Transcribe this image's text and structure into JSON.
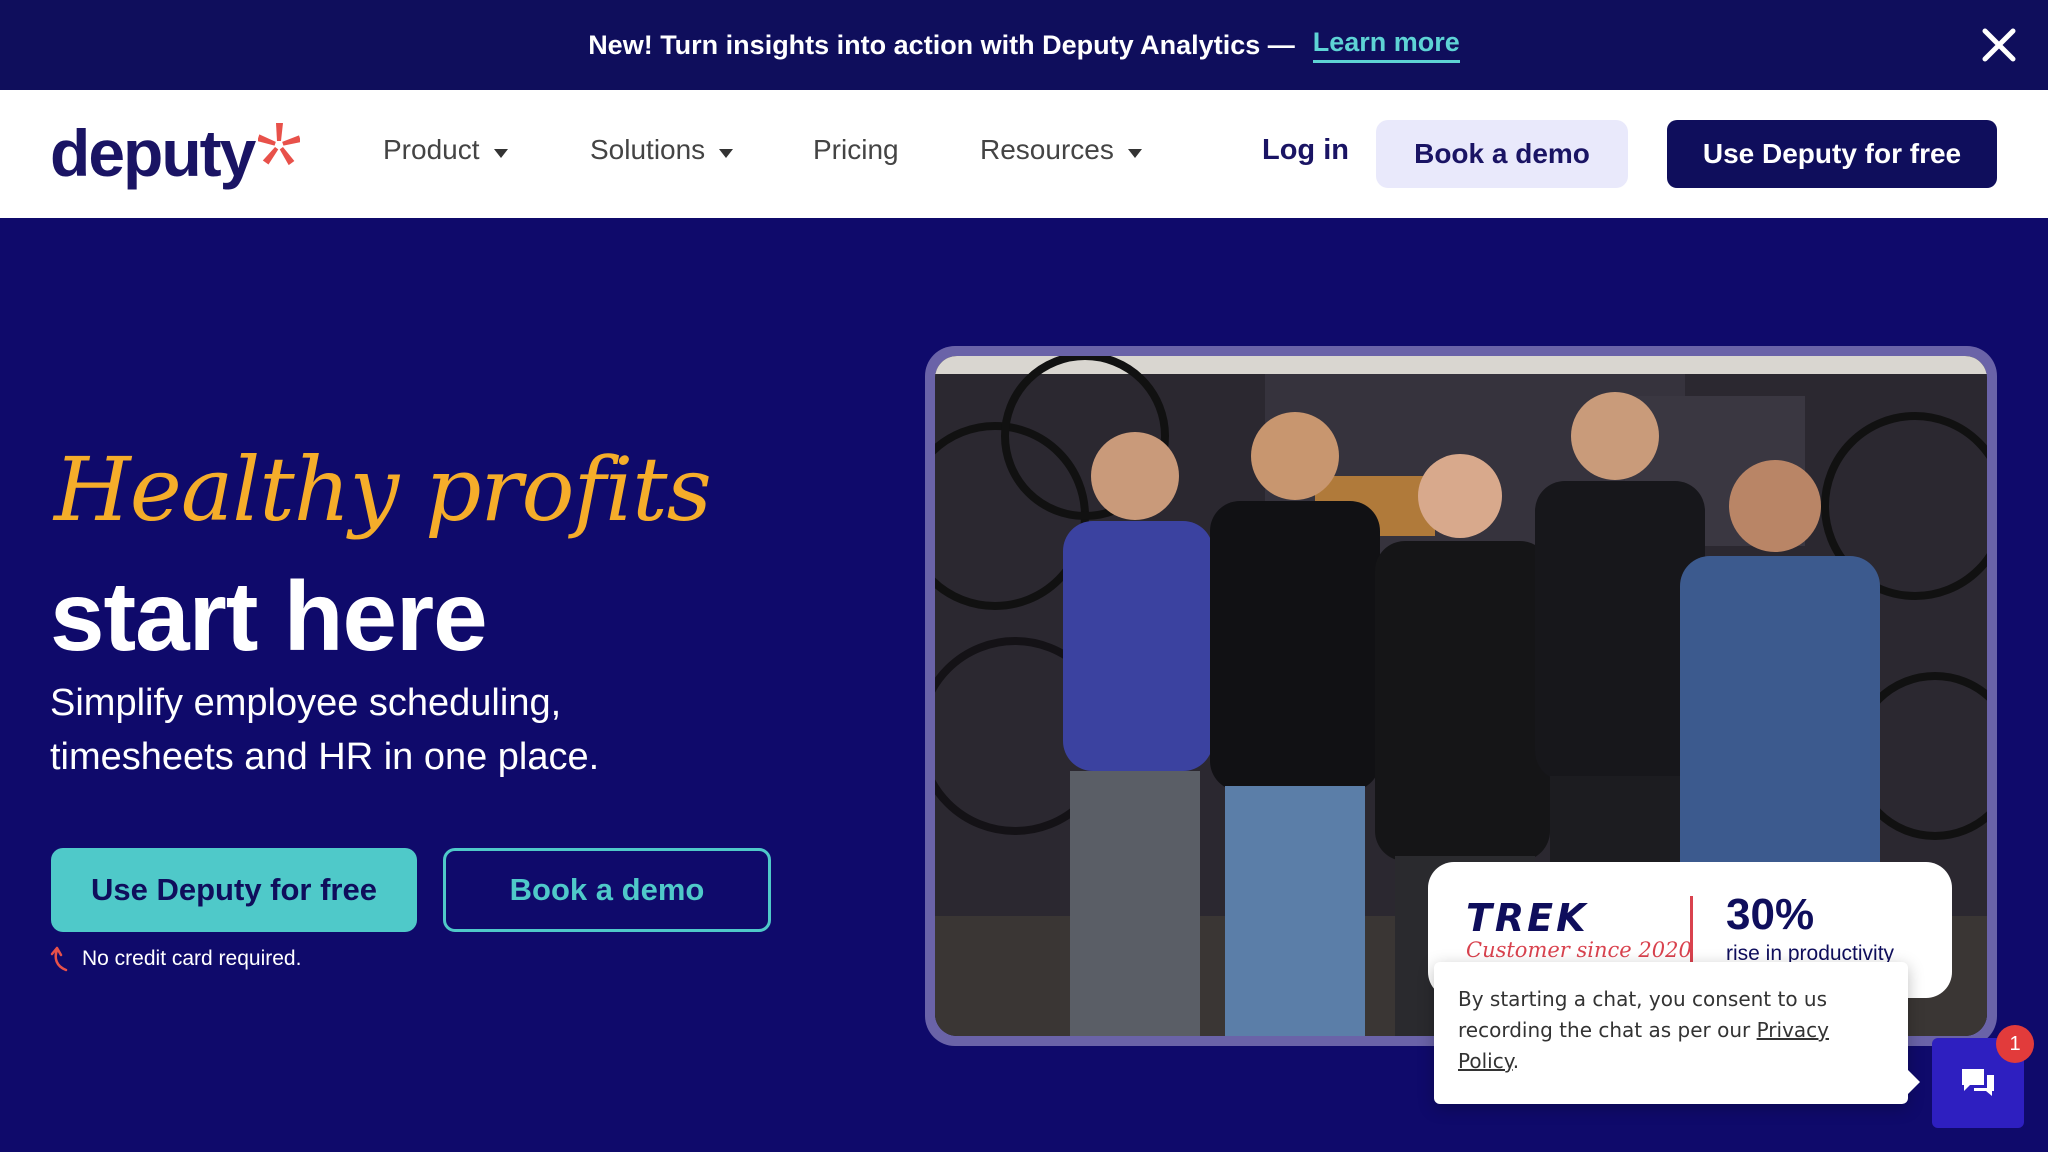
{
  "announcement": {
    "message": "New! Turn insights into action with Deputy Analytics —",
    "link": "Learn more"
  },
  "nav": {
    "logo": "deputy",
    "items": [
      {
        "label": "Product",
        "has_caret": true
      },
      {
        "label": "Solutions",
        "has_caret": true
      },
      {
        "label": "Pricing",
        "has_caret": false
      },
      {
        "label": "Resources",
        "has_caret": true
      }
    ],
    "login": "Log in",
    "book_demo": "Book a demo",
    "use_free": "Use Deputy for free"
  },
  "hero": {
    "script_line": "Healthy profits",
    "title": "start here",
    "subtitle": "Simplify employee scheduling, timesheets and HR in one place.",
    "cta_primary": "Use Deputy for free",
    "cta_secondary": "Book a demo",
    "note": "No credit card required."
  },
  "testimonial_card": {
    "brand": "TREK",
    "since": "Customer since 2020",
    "stat_value": "30%",
    "stat_label": "rise in productivity"
  },
  "chat": {
    "consent_text": "By starting a chat, you consent to us recording the chat as per our",
    "privacy_link": "Privacy Policy",
    "consent_end": ".",
    "badge_count": "1"
  },
  "colors": {
    "navy": "#0f0e5c",
    "hero_bg": "#0f0a6b",
    "accent_teal": "#4fc9c9",
    "accent_orange": "#f5ad2a",
    "accent_red": "#d9424e"
  }
}
